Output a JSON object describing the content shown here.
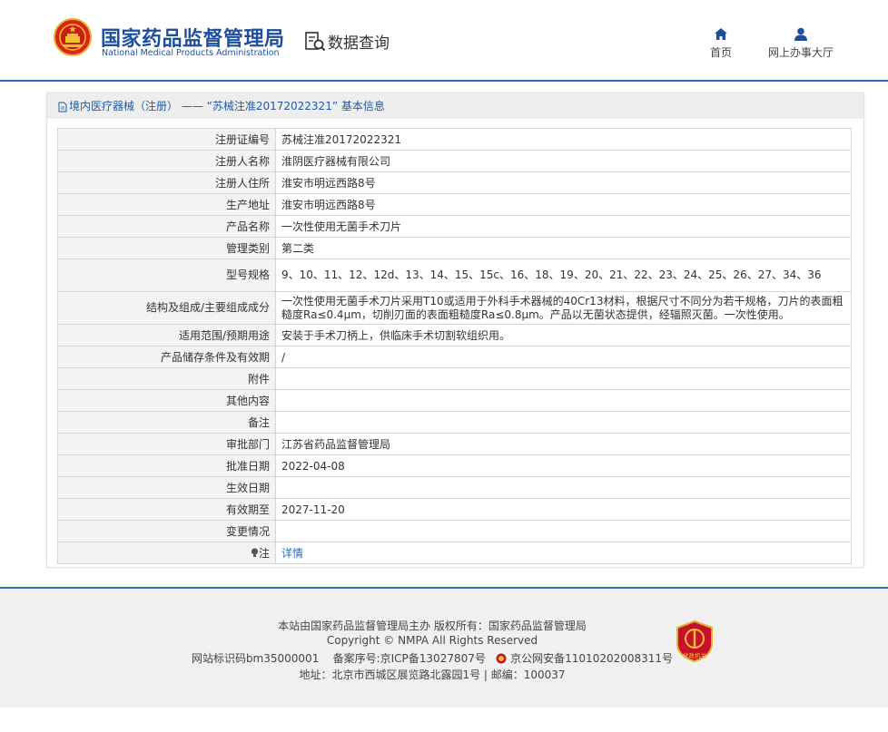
{
  "header": {
    "logo_cn": "国家药品监督管理局",
    "logo_en": "National Medical Products Administration",
    "section_title": "数据查询",
    "icons": {
      "emblem": "national-emblem-icon",
      "search": "data-search-icon"
    },
    "nav": [
      {
        "label": "首页",
        "icon": "home-icon"
      },
      {
        "label": "网上办事大厅",
        "icon": "user-icon"
      }
    ],
    "colors": {
      "brand": "#1e4f9c",
      "accent": "#2f6bb2"
    }
  },
  "panel": {
    "title": "境内医疗器械（注册） —— “苏械注准20172022321” 基本信息"
  },
  "records": [
    {
      "label": "注册证编号",
      "value": "苏械注准20172022321"
    },
    {
      "label": "注册人名称",
      "value": "淮阴医疗器械有限公司"
    },
    {
      "label": "注册人住所",
      "value": "淮安市明远西路8号"
    },
    {
      "label": "生产地址",
      "value": "淮安市明远西路8号"
    },
    {
      "label": "产品名称",
      "value": "一次性使用无菌手术刀片"
    },
    {
      "label": "管理类别",
      "value": "第二类"
    },
    {
      "label": "型号规格",
      "value": "9、10、11、12、12d、13、14、15、15c、16、18、19、20、21、22、23、24、25、26、27、34、36"
    },
    {
      "label": "结构及组成/主要组成成分",
      "value": "一次性使用无菌手术刀片采用T10或适用于外科手术器械的40Cr13材料，根据尺寸不同分为若干规格，刀片的表面粗糙度Ra≤0.4μm，切削刃面的表面粗糙度Ra≤0.8μm。产品以无菌状态提供，经辐照灭菌。一次性使用。"
    },
    {
      "label": "适用范围/预期用途",
      "value": "安装于手术刀柄上，供临床手术切割软组织用。"
    },
    {
      "label": "产品储存条件及有效期",
      "value": "/"
    },
    {
      "label": "附件",
      "value": ""
    },
    {
      "label": "其他内容",
      "value": ""
    },
    {
      "label": "备注",
      "value": ""
    },
    {
      "label": "审批部门",
      "value": "江苏省药品监督管理局"
    },
    {
      "label": "批准日期",
      "value": "2022-04-08"
    },
    {
      "label": "生效日期",
      "value": ""
    },
    {
      "label": "有效期至",
      "value": "2027-11-20"
    },
    {
      "label": "变更情况",
      "value": ""
    }
  ],
  "note": {
    "label": "注",
    "link": "详情",
    "icon": "bulb-icon"
  },
  "footer": {
    "line1": "本站由国家药品监督管理局主办 版权所有：国家药品监督管理局",
    "line2": "Copyright © NMPA All Rights Reserved",
    "site_id": "网站标识码bm35000001",
    "icp": "备案序号:京ICP备13027807号",
    "police": "京公网安备11010202008311号",
    "address": "地址：北京市西城区展览路北露园1号 | 邮编：100037",
    "badge_icon": "government-website-badge-icon",
    "badge_text": "党政机关"
  }
}
